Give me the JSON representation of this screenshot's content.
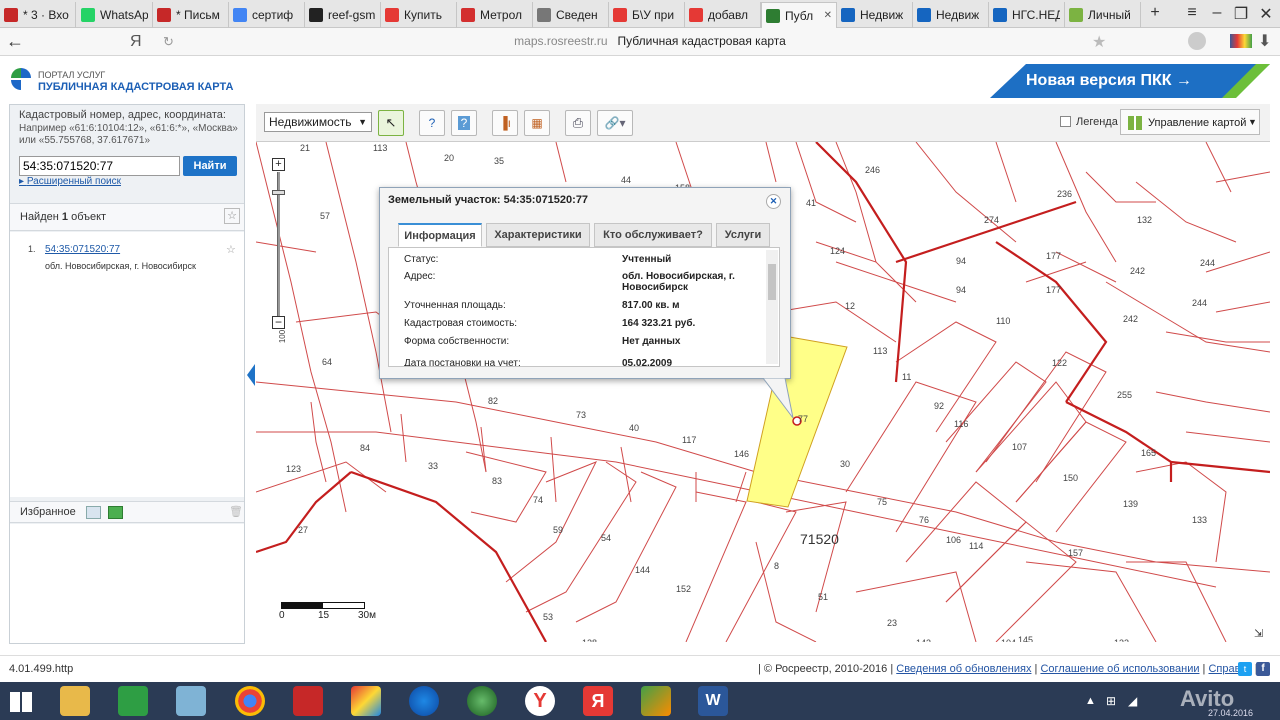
{
  "browser": {
    "tabs": [
      {
        "label": "* 3 · Вхо",
        "icon": "mail-icon",
        "color": "#c62828"
      },
      {
        "label": "WhatsApp",
        "icon": "whatsapp-icon",
        "color": "#25d366"
      },
      {
        "label": "* Письм",
        "icon": "mail-icon",
        "color": "#c62828"
      },
      {
        "label": "сертиф",
        "icon": "google-icon",
        "color": "#4285f4"
      },
      {
        "label": "reef-gsm",
        "icon": "spider-icon",
        "color": "#222222"
      },
      {
        "label": "Купить",
        "icon": "avito-icon",
        "color": "#e53935"
      },
      {
        "label": "Метрол",
        "icon": "warning-icon",
        "color": "#d32f2f"
      },
      {
        "label": "Сведен",
        "icon": "document-icon",
        "color": "#777777"
      },
      {
        "label": "Б\\У при",
        "icon": "triangle-icon",
        "color": "#e53935"
      },
      {
        "label": "добавл",
        "icon": "yandex-icon",
        "color": "#e53935"
      },
      {
        "label": "Публ",
        "icon": "rosreestr-icon",
        "color": "#2e7d32"
      },
      {
        "label": "Недвиж",
        "icon": "ngs-icon",
        "color": "#1565c0"
      },
      {
        "label": "Недвиж",
        "icon": "ngs-icon",
        "color": "#1565c0"
      },
      {
        "label": "НГС.НЕД",
        "icon": "ngs-icon",
        "color": "#1565c0"
      },
      {
        "label": "Личный",
        "icon": "grid-icon",
        "color": "#7cb342"
      }
    ],
    "new_tab": "+",
    "address_host": "maps.rosreestr.ru",
    "address_title": "Публичная кадастровая карта",
    "yandex_letter": "Я"
  },
  "header": {
    "portal_label": "ПОРТАЛ УСЛУГ",
    "portal_title": "ПУБЛИЧНАЯ КАДАСТРОВАЯ КАРТА",
    "new_version": "Новая версия ПКК →"
  },
  "search": {
    "hint": "Кадастровый номер, адрес, координата:",
    "example": "Например «61:6:10104:12», «61:6:*», «Москва» или «55.755768, 37.617671»",
    "value": "54:35:071520:77",
    "button": "Найти",
    "advanced": "Расширенный поиск"
  },
  "results": {
    "found_prefix": "Найден",
    "found_count": "1",
    "found_suffix": "объект",
    "items": [
      {
        "num": "1.",
        "cadastral": "54:35:071520:77",
        "address": "обл. Новосибирская, г. Новосибирск"
      }
    ]
  },
  "favorites": {
    "title": "Избранное"
  },
  "toolbar": {
    "layer_select": "Недвижимость",
    "legend": "Легенда",
    "map_control": "Управление картой"
  },
  "map": {
    "quarter_label": "71520",
    "scale_labels": [
      "0",
      "15",
      "30м"
    ],
    "zoom_in": "+",
    "zoom_out": "−",
    "zoom_level_label": "100",
    "selected_parcel_label": "77",
    "parcel_labels": [
      "21",
      "113",
      "20",
      "35",
      "44",
      "158",
      "246",
      "41",
      "274",
      "236",
      "132",
      "57",
      "124",
      "94",
      "177",
      "242",
      "244",
      "94",
      "177",
      "12",
      "110",
      "244",
      "242",
      "64",
      "113",
      "11",
      "122",
      "82",
      "73",
      "40",
      "117",
      "92",
      "255",
      "84",
      "33",
      "146",
      "116",
      "107",
      "123",
      "83",
      "30",
      "165",
      "74",
      "75",
      "150",
      "139",
      "59",
      "54",
      "76",
      "27",
      "106",
      "114",
      "133",
      "157",
      "144",
      "152",
      "8",
      "53",
      "51",
      "23",
      "128",
      "143",
      "104",
      "145",
      "132"
    ]
  },
  "popup": {
    "title": "Земельный участок: 54:35:071520:77",
    "tabs": [
      "Информация",
      "Характеристики",
      "Кто обслуживает?",
      "Услуги"
    ],
    "rows": [
      {
        "key": "Статус:",
        "value": "Учтенный"
      },
      {
        "key": "Адрес:",
        "value": "обл. Новосибирская, г. Новосибирск"
      },
      {
        "key": "Уточненная площадь:",
        "value": "817.00 кв. м"
      },
      {
        "key": "Кадастровая стоимость:",
        "value": "164 323.21 руб."
      },
      {
        "key": "Форма собственности:",
        "value": "Нет данных"
      },
      {
        "key": "Дата постановки на учет:",
        "value": "05.02.2009"
      }
    ]
  },
  "footer": {
    "version": "4.01.499.http",
    "copyright": "© Росреестр, 2010-2016",
    "updates": "Сведения об обновлениях",
    "agreement": "Соглашение об использовании",
    "help": "Справка"
  },
  "taskbar": {
    "date": "27.04.2016",
    "watermark": "Avito"
  }
}
